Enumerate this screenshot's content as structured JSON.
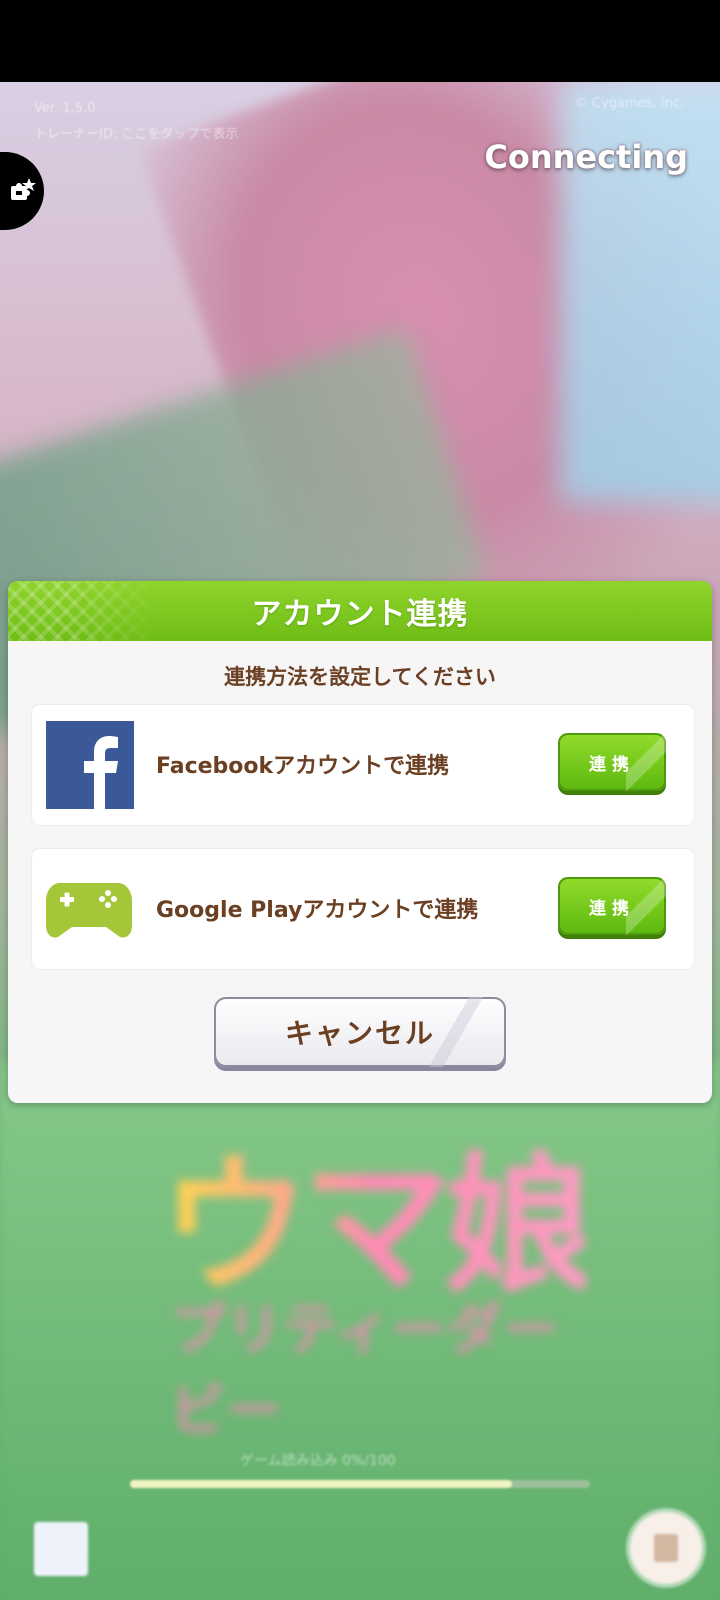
{
  "header": {
    "version": "Ver. 1.5.0",
    "hint": "トレーナーID: ここをタップで表示",
    "copyright": "© Cygames, Inc.",
    "status": "Connecting"
  },
  "dialog": {
    "title": "アカウント連携",
    "subtitle": "連携方法を設定してください",
    "options": [
      {
        "label": "Facebookアカウントで連携",
        "button": "連携",
        "icon": "facebook-icon"
      },
      {
        "label": "Google Playアカウントで連携",
        "button": "連携",
        "icon": "gamepad-icon"
      }
    ],
    "cancel": "キャンセル"
  },
  "logo": {
    "main": "ウマ娘",
    "sub": "プリティーダービー"
  },
  "loading": {
    "text": "ゲーム読み込み 0%/100",
    "progress": 0.83
  },
  "colors": {
    "accent_green": "#6fbd16",
    "text_brown": "#6b3f22",
    "facebook_blue": "#3b5998",
    "gamepad_green": "#a4c639"
  }
}
